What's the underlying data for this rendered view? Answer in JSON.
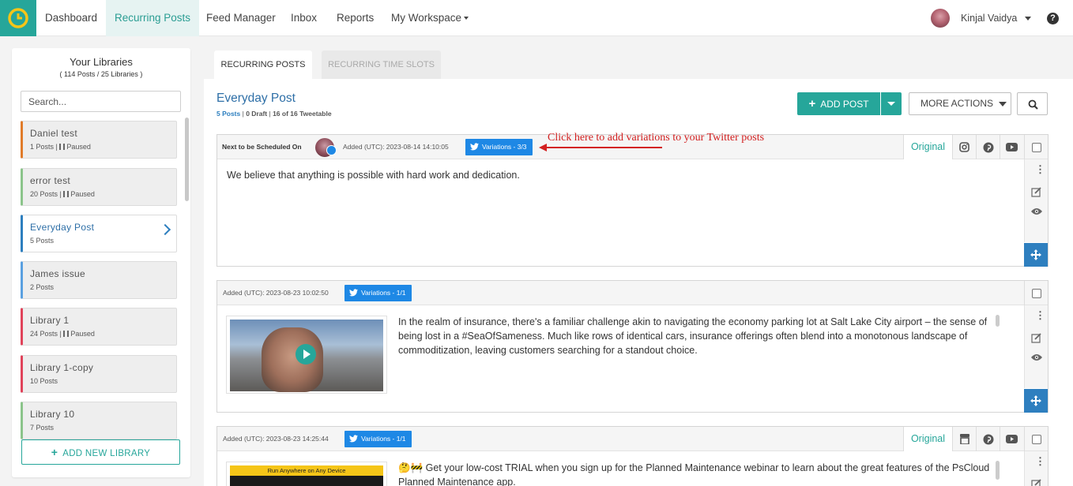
{
  "nav": {
    "items": [
      "Dashboard",
      "Recurring Posts",
      "Feed Manager",
      "Inbox",
      "Reports",
      "My Workspace"
    ],
    "active": "Recurring Posts",
    "user_name": "Kinjal Vaidya",
    "help": "?"
  },
  "sidebar": {
    "title": "Your Libraries",
    "subtitle": "( 114 Posts / 25 Libraries )",
    "search_placeholder": "Search...",
    "libraries": [
      {
        "name": "Daniel test",
        "posts": "1 Posts",
        "status": "Paused",
        "color": "#e07b2a"
      },
      {
        "name": "error test",
        "posts": "20 Posts",
        "status": "Paused",
        "color": "#8bc48a"
      },
      {
        "name": "Everyday Post",
        "posts": "5 Posts",
        "status": "",
        "color": "#2e7fbf"
      },
      {
        "name": "James issue",
        "posts": "2 Posts",
        "status": "",
        "color": "#5aa0e0"
      },
      {
        "name": "Library 1",
        "posts": "24 Posts",
        "status": "Paused",
        "color": "#e0435a"
      },
      {
        "name": "Library 1-copy",
        "posts": "10 Posts",
        "status": "",
        "color": "#e0435a"
      },
      {
        "name": "Library 10",
        "posts": "7 Posts",
        "status": "",
        "color": "#8bc48a"
      }
    ],
    "add_library": "ADD NEW LIBRARY"
  },
  "tabs": {
    "active": "RECURRING POSTS",
    "inactive": "RECURRING TIME SLOTS"
  },
  "library": {
    "title": "Everyday Post",
    "posts": "5 Posts",
    "draft": "0 Draft",
    "tweetable": "16 of 16 Tweetable"
  },
  "toolbar": {
    "add_post": "ADD POST",
    "more_actions": "MORE ACTIONS"
  },
  "annotation": "Click here to add variations to your Twitter posts",
  "posts": [
    {
      "next_label": "Next to be Scheduled On",
      "added": "Added (UTC): 2023-08-14 14:10:05",
      "variations": "Variations - 3/3",
      "tab": "Original",
      "icons": [
        "instagram-icon",
        "pinterest-icon",
        "youtube-icon"
      ],
      "text": "We believe that anything is possible with hard work and dedication."
    },
    {
      "added": "Added (UTC): 2023-08-23 10:02:50",
      "variations": "Variations - 1/1",
      "text": "In the realm of insurance, there's a familiar challenge akin to navigating the economy parking lot at Salt Lake City airport – the sense of being lost in a #SeaOfSameness. Much like rows of identical cars, insurance offerings often blend into a monotonous landscape of commoditization, leaving customers searching for a standout choice."
    },
    {
      "added": "Added (UTC): 2023-08-23 14:25:44",
      "variations": "Variations - 1/1",
      "tab": "Original",
      "icons": [
        "google-business-icon",
        "pinterest-icon",
        "youtube-icon"
      ],
      "emoji": "🤔🚧",
      "text": "Get your low-cost TRIAL when you sign up for the Planned Maintenance webinar to learn about the great features of the PsCloud Planned Maintenance app.",
      "thumb_text": "Run Anywhere on Any Device"
    }
  ]
}
